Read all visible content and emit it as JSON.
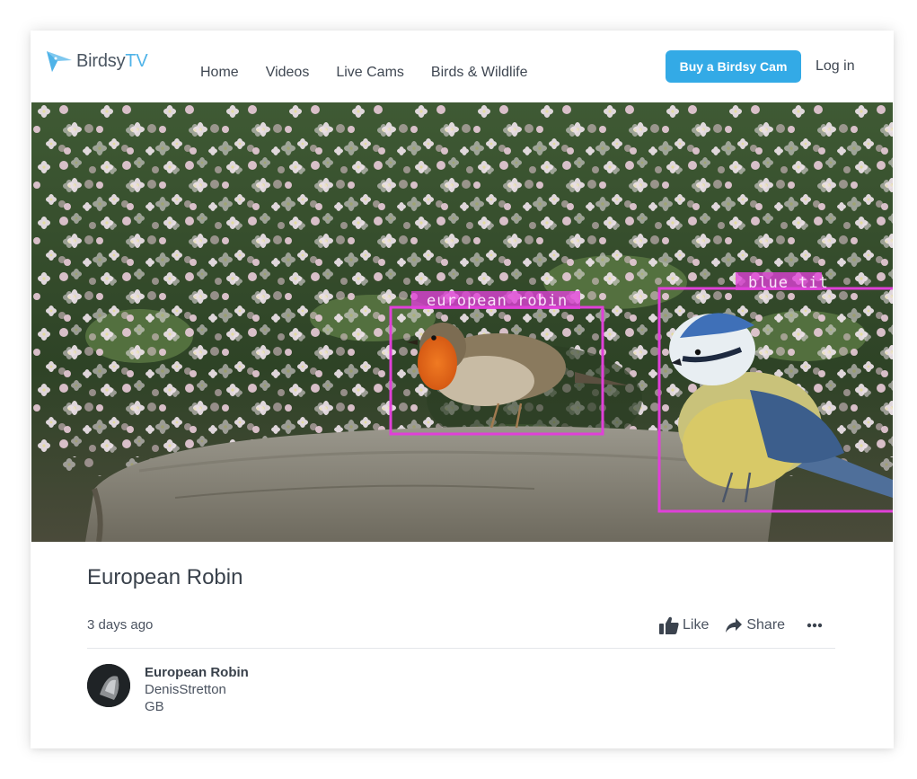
{
  "brand": {
    "name_part1": "Birdsy",
    "name_part2": "TV",
    "accent_color": "#33aae6"
  },
  "nav": {
    "items": [
      {
        "label": "Home"
      },
      {
        "label": "Videos"
      },
      {
        "label": "Live Cams"
      },
      {
        "label": "Birds & Wildlife"
      }
    ]
  },
  "header": {
    "buy_label": "Buy a Birdsy Cam",
    "login_label": "Log in"
  },
  "video": {
    "detections": [
      {
        "label": "european robin",
        "color": "#e040d8"
      },
      {
        "label": "blue tit",
        "color": "#e040d8"
      }
    ]
  },
  "post": {
    "title": "European Robin",
    "age": "3 days ago",
    "like_label": "Like",
    "share_label": "Share",
    "more_icon": "ellipsis-icon"
  },
  "uploader": {
    "bird": "European Robin",
    "user": "DenisStretton",
    "country": "GB"
  }
}
